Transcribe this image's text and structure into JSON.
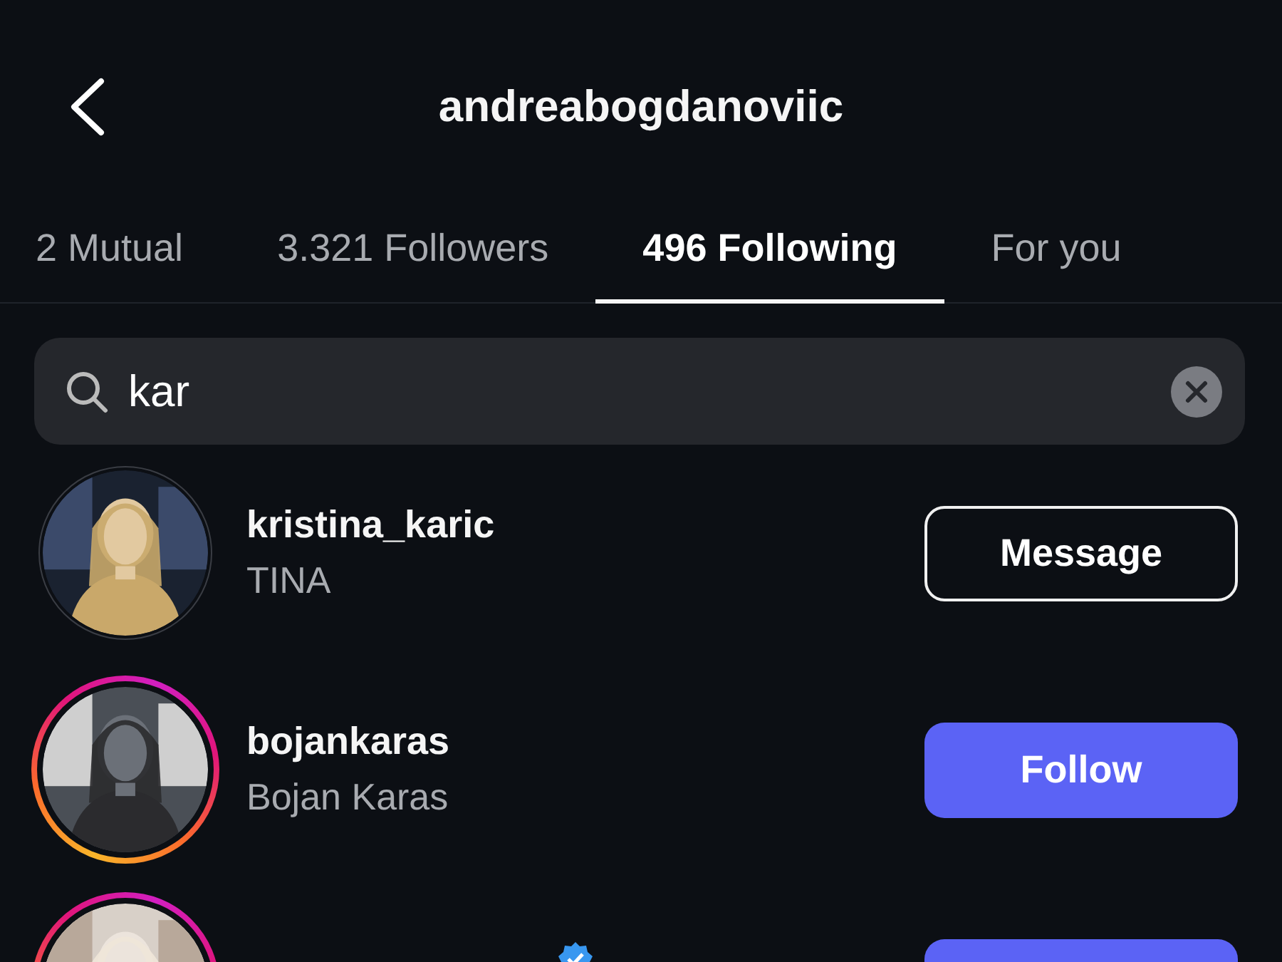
{
  "header": {
    "title": "andreabogdanoviic"
  },
  "tabs": [
    {
      "label": "2 Mutual",
      "selected": false
    },
    {
      "label": "3.321 Followers",
      "selected": false
    },
    {
      "label": "496 Following",
      "selected": true
    },
    {
      "label": "For you",
      "selected": false
    }
  ],
  "search": {
    "value": "kar"
  },
  "users": [
    {
      "username": "kristina_karic",
      "name": "TINA",
      "story": false,
      "verified": false,
      "button": {
        "kind": "message",
        "label": "Message"
      }
    },
    {
      "username": "bojankaras",
      "name": "Bojan Karas",
      "story": true,
      "verified": false,
      "button": {
        "kind": "follow",
        "label": "Follow"
      }
    },
    {
      "story": true,
      "verified": true,
      "button": {
        "kind": "follow"
      }
    }
  ]
}
